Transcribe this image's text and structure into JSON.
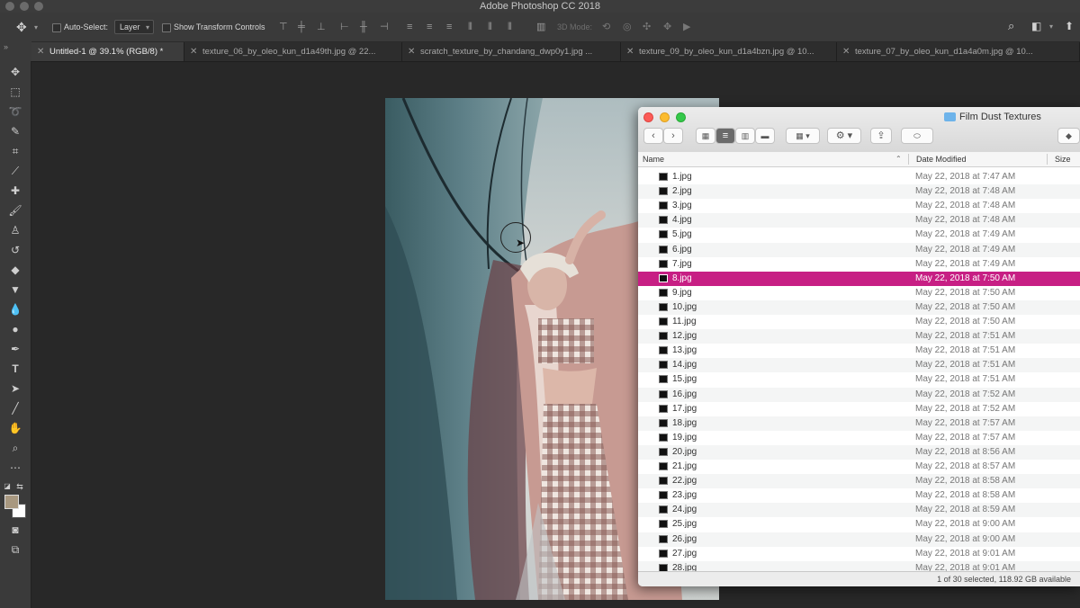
{
  "app": {
    "title": "Adobe Photoshop CC 2018"
  },
  "options_bar": {
    "auto_select_label": "Auto-Select:",
    "auto_select_value": "Layer",
    "show_transform_label": "Show Transform Controls",
    "mode_3d_label": "3D Mode:"
  },
  "tabs": [
    {
      "label": "Untitled-1 @ 39.1% (RGB/8) *",
      "active": true
    },
    {
      "label": "texture_06_by_oleo_kun_d1a49th.jpg @ 22...",
      "active": false
    },
    {
      "label": "scratch_texture_by_chandang_dwp0y1.jpg ...",
      "active": false
    },
    {
      "label": "texture_09_by_oleo_kun_d1a4bzn.jpg @ 10...",
      "active": false
    },
    {
      "label": "texture_07_by_oleo_kun_d1a4a0m.jpg @ 10...",
      "active": false
    }
  ],
  "tools": [
    "move-tool",
    "marquee-tool",
    "lasso-tool",
    "quick-select-tool",
    "crop-tool",
    "eyedropper-tool",
    "healing-tool",
    "brush-tool",
    "stamp-tool",
    "history-brush-tool",
    "eraser-tool",
    "paint-bucket-tool",
    "blur-tool",
    "dodge-tool",
    "pen-tool",
    "type-tool",
    "path-select-tool",
    "line-tool",
    "hand-tool",
    "zoom-tool",
    "more-tools"
  ],
  "colors": {
    "foreground": "#a89880",
    "background": "#ffffff",
    "selection": "#c71f84"
  },
  "finder": {
    "title": "Film Dust Textures",
    "columns": {
      "name": "Name",
      "date": "Date Modified",
      "size": "Size"
    },
    "files": [
      {
        "name": "1.jpg",
        "date": "May 22, 2018 at 7:47 AM"
      },
      {
        "name": "2.jpg",
        "date": "May 22, 2018 at 7:48 AM"
      },
      {
        "name": "3.jpg",
        "date": "May 22, 2018 at 7:48 AM"
      },
      {
        "name": "4.jpg",
        "date": "May 22, 2018 at 7:48 AM"
      },
      {
        "name": "5.jpg",
        "date": "May 22, 2018 at 7:49 AM"
      },
      {
        "name": "6.jpg",
        "date": "May 22, 2018 at 7:49 AM"
      },
      {
        "name": "7.jpg",
        "date": "May 22, 2018 at 7:49 AM"
      },
      {
        "name": "8.jpg",
        "date": "May 22, 2018 at 7:50 AM",
        "selected": true
      },
      {
        "name": "9.jpg",
        "date": "May 22, 2018 at 7:50 AM"
      },
      {
        "name": "10.jpg",
        "date": "May 22, 2018 at 7:50 AM"
      },
      {
        "name": "11.jpg",
        "date": "May 22, 2018 at 7:50 AM"
      },
      {
        "name": "12.jpg",
        "date": "May 22, 2018 at 7:51 AM"
      },
      {
        "name": "13.jpg",
        "date": "May 22, 2018 at 7:51 AM"
      },
      {
        "name": "14.jpg",
        "date": "May 22, 2018 at 7:51 AM"
      },
      {
        "name": "15.jpg",
        "date": "May 22, 2018 at 7:51 AM"
      },
      {
        "name": "16.jpg",
        "date": "May 22, 2018 at 7:52 AM"
      },
      {
        "name": "17.jpg",
        "date": "May 22, 2018 at 7:52 AM"
      },
      {
        "name": "18.jpg",
        "date": "May 22, 2018 at 7:57 AM"
      },
      {
        "name": "19.jpg",
        "date": "May 22, 2018 at 7:57 AM"
      },
      {
        "name": "20.jpg",
        "date": "May 22, 2018 at 8:56 AM"
      },
      {
        "name": "21.jpg",
        "date": "May 22, 2018 at 8:57 AM"
      },
      {
        "name": "22.jpg",
        "date": "May 22, 2018 at 8:58 AM"
      },
      {
        "name": "23.jpg",
        "date": "May 22, 2018 at 8:58 AM"
      },
      {
        "name": "24.jpg",
        "date": "May 22, 2018 at 8:59 AM"
      },
      {
        "name": "25.jpg",
        "date": "May 22, 2018 at 9:00 AM"
      },
      {
        "name": "26.jpg",
        "date": "May 22, 2018 at 9:00 AM"
      },
      {
        "name": "27.jpg",
        "date": "May 22, 2018 at 9:01 AM"
      },
      {
        "name": "28.jpg",
        "date": "May 22, 2018 at 9:01 AM"
      }
    ],
    "status": "1 of 30 selected, 118.92 GB available"
  }
}
